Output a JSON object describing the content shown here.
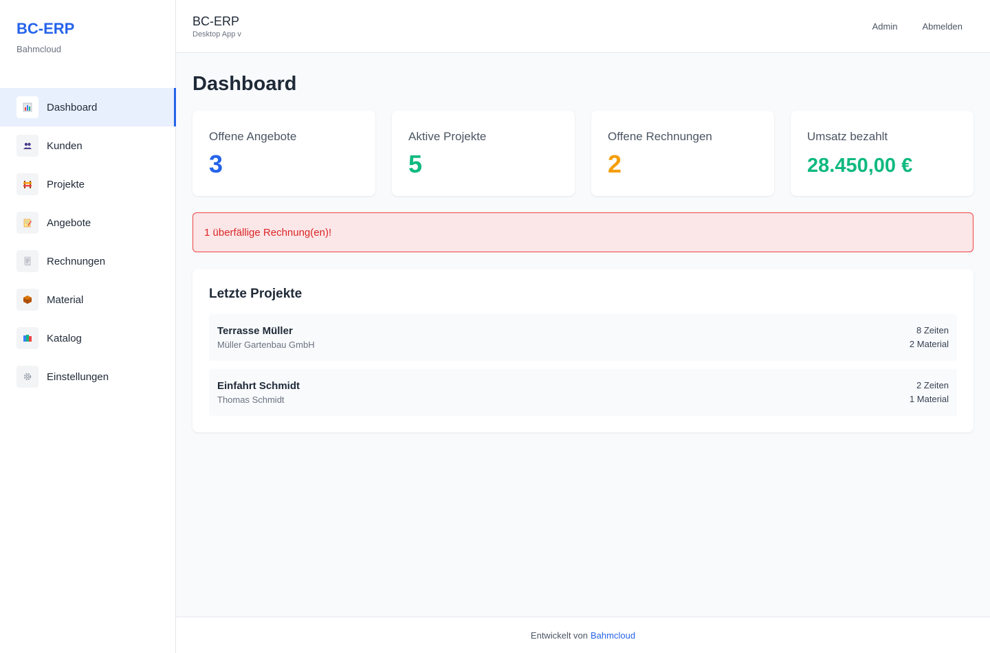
{
  "sidebar": {
    "brand_title": "BC-ERP",
    "brand_sub": "Bahmcloud",
    "items": [
      {
        "label": "Dashboard",
        "icon": "bar-chart-icon",
        "active": true
      },
      {
        "label": "Kunden",
        "icon": "users-icon",
        "active": false
      },
      {
        "label": "Projekte",
        "icon": "construction-icon",
        "active": false
      },
      {
        "label": "Angebote",
        "icon": "memo-icon",
        "active": false
      },
      {
        "label": "Rechnungen",
        "icon": "receipt-icon",
        "active": false
      },
      {
        "label": "Material",
        "icon": "package-icon",
        "active": false
      },
      {
        "label": "Katalog",
        "icon": "books-icon",
        "active": false
      },
      {
        "label": "Einstellungen",
        "icon": "gear-icon",
        "active": false
      }
    ]
  },
  "header": {
    "title": "BC-ERP",
    "subtitle": "Desktop App v",
    "admin_label": "Admin",
    "logout_label": "Abmelden"
  },
  "main": {
    "page_title": "Dashboard",
    "stats": [
      {
        "label": "Offene Angebote",
        "value": "3",
        "color": "#2563eb"
      },
      {
        "label": "Aktive Projekte",
        "value": "5",
        "color": "#10b981"
      },
      {
        "label": "Offene Rechnungen",
        "value": "2",
        "color": "#f59e0b"
      },
      {
        "label": "Umsatz bezahlt",
        "value": "28.450,00 €",
        "color": "#10b981"
      }
    ],
    "alert_text": "1 überfällige Rechnung(en)!",
    "recent_projects": {
      "title": "Letzte Projekte",
      "items": [
        {
          "name": "Terrasse Müller",
          "client": "Müller Gartenbau GmbH",
          "times": "8 Zeiten",
          "material": "2 Material"
        },
        {
          "name": "Einfahrt Schmidt",
          "client": "Thomas Schmidt",
          "times": "2 Zeiten",
          "material": "1 Material"
        }
      ]
    }
  },
  "footer": {
    "text": "Entwickelt von",
    "link": "Bahmcloud"
  },
  "colors": {
    "accent": "#2563eb",
    "success": "#10b981",
    "warning": "#f59e0b",
    "danger": "#dc2626"
  }
}
